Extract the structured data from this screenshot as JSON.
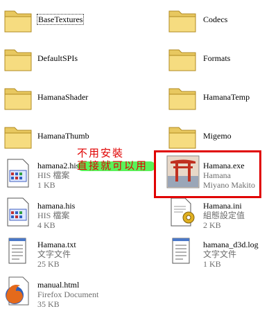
{
  "files": [
    {
      "name": "BaseTextures",
      "type": "folder"
    },
    {
      "name": "Codecs",
      "type": "folder"
    },
    {
      "name": "DefaultSPIs",
      "type": "folder"
    },
    {
      "name": "Formats",
      "type": "folder"
    },
    {
      "name": "HamanaShader",
      "type": "folder"
    },
    {
      "name": "HamanaTemp",
      "type": "folder"
    },
    {
      "name": "HamanaThumb",
      "type": "folder"
    },
    {
      "name": "Migemo",
      "type": "folder"
    },
    {
      "name": "hamana2.his",
      "line2": "HIS 檔案",
      "line3": "1 KB"
    },
    {
      "name": "Hamana.exe",
      "line2": "Hamana",
      "line3": "Miyano Makito"
    },
    {
      "name": "hamana.his",
      "line2": "HIS 檔案",
      "line3": "4 KB"
    },
    {
      "name": "Hamana.ini",
      "line2": "組態設定值",
      "line3": "2 KB"
    },
    {
      "name": "Hamana.txt",
      "line2": "文字文件",
      "line3": "25 KB"
    },
    {
      "name": "hamana_d3d.log",
      "line2": "文字文件",
      "line3": "1 KB"
    },
    {
      "name": "manual.html",
      "line2": "Firefox Document",
      "line3": "35 KB"
    }
  ],
  "annotation": {
    "line1": "不用安裝",
    "line2": "直接就可以用",
    "color": "#e00000"
  }
}
